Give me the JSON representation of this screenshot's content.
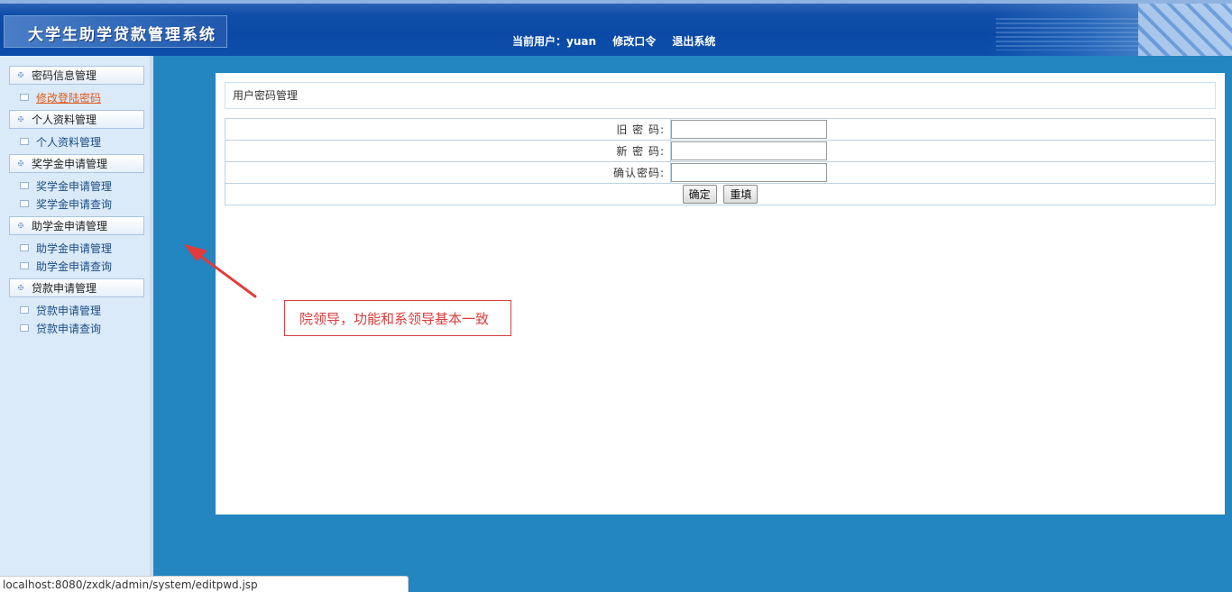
{
  "header": {
    "app_title": "大学生助学贷款管理系统",
    "current_user_label": "当前用户：",
    "current_user": "yuan",
    "change_password": "修改口令",
    "logout": "退出系统"
  },
  "sidebar": {
    "groups": [
      {
        "label": "密码信息管理",
        "items": [
          {
            "label": "修改登陆密码",
            "active": true
          }
        ]
      },
      {
        "label": "个人资料管理",
        "items": [
          {
            "label": "个人资料管理"
          }
        ]
      },
      {
        "label": "奖学金申请管理",
        "items": [
          {
            "label": "奖学金申请管理"
          },
          {
            "label": "奖学金申请查询"
          }
        ]
      },
      {
        "label": "助学金申请管理",
        "items": [
          {
            "label": "助学金申请管理"
          },
          {
            "label": "助学金申请查询"
          }
        ]
      },
      {
        "label": "贷款申请管理",
        "items": [
          {
            "label": "贷款申请管理"
          },
          {
            "label": "贷款申请查询"
          }
        ]
      }
    ]
  },
  "main": {
    "title": "用户密码管理",
    "form": {
      "old_password_label": "旧 密 码:",
      "old_password_value": "",
      "new_password_label": "新 密 码:",
      "new_password_value": "",
      "confirm_password_label": "确认密码:",
      "confirm_password_value": "",
      "submit_label": "确定",
      "reset_label": "重填"
    }
  },
  "annotation": {
    "text": "院领导，功能和系领导基本一致",
    "color": "#d93c3c"
  },
  "statusbar": {
    "url": "localhost:8080/zxdk/admin/system/editpwd.jsp"
  },
  "colors": {
    "page_background": "#2386c0",
    "header": "#0a4aa6",
    "sidebar": "#dbeaf8",
    "active_link": "#e05a1c"
  }
}
